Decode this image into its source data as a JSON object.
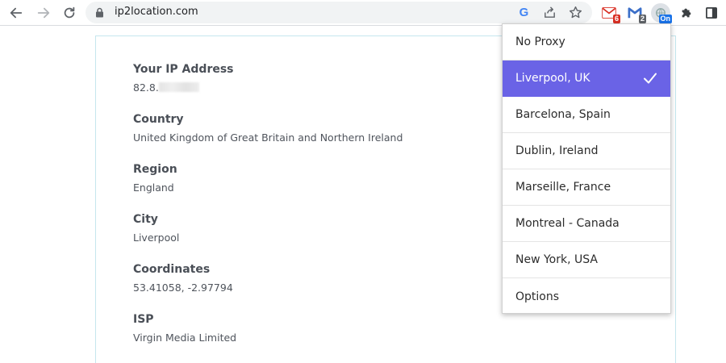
{
  "browser": {
    "url": "ip2location.com",
    "extensions": {
      "gmail_badge": "6",
      "ext2_badge": "2",
      "proxy_badge": "On"
    }
  },
  "location_info": {
    "fields": [
      {
        "label": "Your IP Address",
        "value": "82.8."
      },
      {
        "label": "Country",
        "value": "United Kingdom of Great Britain and Northern Ireland"
      },
      {
        "label": "Region",
        "value": "England"
      },
      {
        "label": "City",
        "value": "Liverpool"
      },
      {
        "label": "Coordinates",
        "value": "53.41058, -2.97794"
      },
      {
        "label": "ISP",
        "value": "Virgin Media Limited"
      }
    ]
  },
  "proxy_menu": {
    "items": [
      {
        "label": "No Proxy",
        "selected": false
      },
      {
        "label": "Liverpool, UK",
        "selected": true
      },
      {
        "label": "Barcelona, Spain",
        "selected": false
      },
      {
        "label": "Dublin, Ireland",
        "selected": false
      },
      {
        "label": "Marseille, France",
        "selected": false
      },
      {
        "label": "Montreal - Canada",
        "selected": false
      },
      {
        "label": "New York, USA",
        "selected": false
      },
      {
        "label": "Options",
        "selected": false
      }
    ]
  },
  "colors": {
    "selected_item_bg": "#6a63e6",
    "card_border": "#c5e6ee",
    "gmail_badge": "#d93025",
    "proxy_badge": "#1a73e8"
  },
  "icons": {
    "back": "back-arrow-icon",
    "forward": "forward-arrow-icon",
    "reload": "reload-icon",
    "lock": "lock-icon",
    "google": "google-icon",
    "share": "share-icon",
    "bookmark": "star-icon",
    "extensions": "puzzle-icon",
    "side_panel": "side-panel-icon",
    "check": "check-icon"
  }
}
